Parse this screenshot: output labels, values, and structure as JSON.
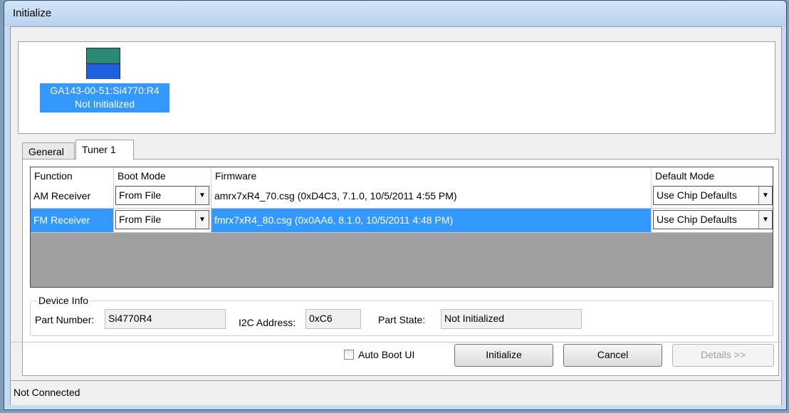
{
  "window": {
    "title": "Initialize"
  },
  "device": {
    "line1": "GA143-00-51:Si4770:R4",
    "line2": "Not Initialized"
  },
  "tabs": [
    {
      "label": "General"
    },
    {
      "label": "Tuner 1"
    }
  ],
  "grid": {
    "headers": {
      "function": "Function",
      "boot_mode": "Boot Mode",
      "firmware": "Firmware",
      "default_mode": "Default Mode"
    },
    "rows": [
      {
        "function": "AM Receiver",
        "boot_mode": "From File",
        "firmware": "amrx7xR4_70.csg (0xD4C3, 7.1.0, 10/5/2011 4:55 PM)",
        "default_mode": "Use Chip Defaults"
      },
      {
        "function": "FM Receiver",
        "boot_mode": "From File",
        "firmware": "fmrx7xR4_80.csg (0x0AA6, 8.1.0, 10/5/2011 4:48 PM)",
        "default_mode": "Use Chip Defaults"
      }
    ]
  },
  "device_info": {
    "title": "Device Info",
    "part_number_label": "Part Number:",
    "part_number": "Si4770R4",
    "i2c_label": "I2C Address:",
    "i2c_address": "0xC6",
    "part_state_label": "Part State:",
    "part_state": "Not Initialized"
  },
  "controls": {
    "auto_boot_label": "Auto Boot UI",
    "initialize_label": "Initialize",
    "cancel_label": "Cancel",
    "details_label": "Details >>"
  },
  "status": {
    "text": "Not Connected"
  }
}
